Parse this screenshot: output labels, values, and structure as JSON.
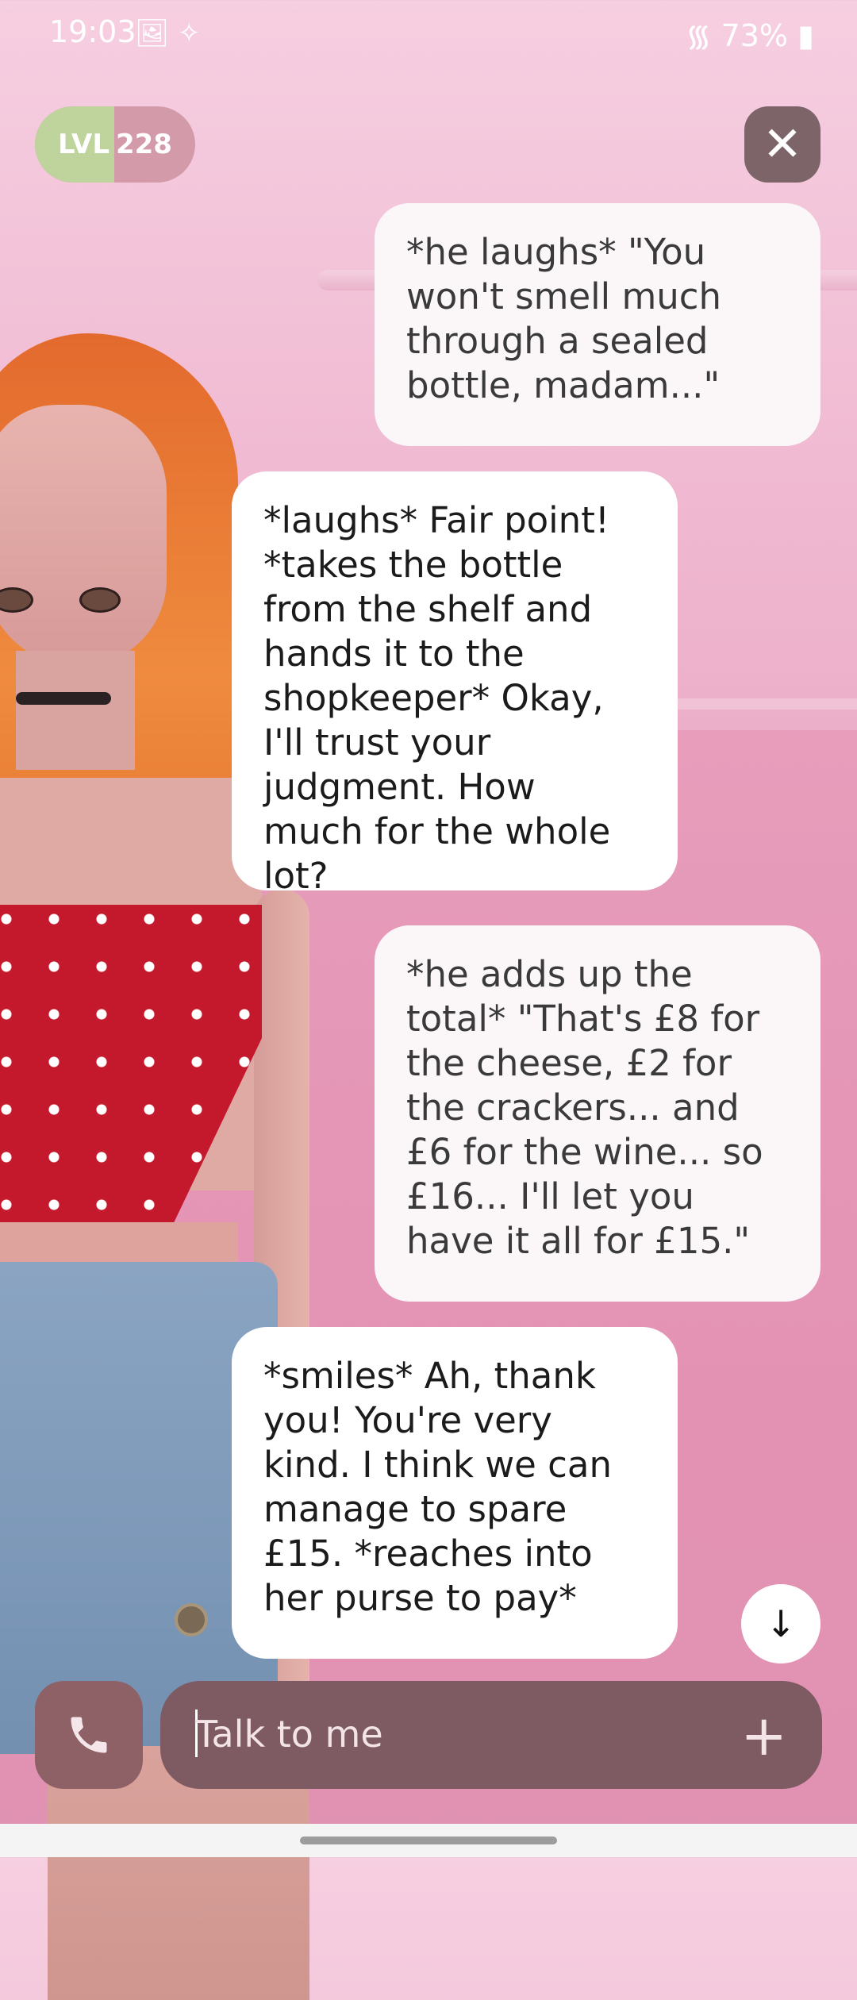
{
  "status_bar": {
    "time": "19:03",
    "left_icons": "🖼 ✧",
    "battery": "73%"
  },
  "level": {
    "prefix": "LVL",
    "value": "228"
  },
  "close_icon": "✕",
  "messages": [
    {
      "role": "npc",
      "text": "*he laughs* \"You won't smell much through a sealed bottle, madam...\""
    },
    {
      "role": "user",
      "text": "*laughs* Fair point! *takes the bottle from the shelf and hands it to the shopkeeper* Okay, I'll trust your judgment. How much for the whole lot?"
    },
    {
      "role": "npc",
      "text": "*he adds up the total* \"That's £8 for the cheese, £2 for the crackers... and £6 for the wine... so £16... I'll let you have it all for £15.\""
    },
    {
      "role": "user",
      "text": "*smiles* Ah, thank you! You're very kind. I think we can manage to spare £15. *reaches into her purse to pay*"
    }
  ],
  "scroll_icon": "↓",
  "input": {
    "placeholder": "Talk to me",
    "add_icon": "+"
  },
  "colors": {
    "accent": "#bfd39c",
    "pill": "#d39aa9",
    "input_bg": "#7e5b62"
  }
}
